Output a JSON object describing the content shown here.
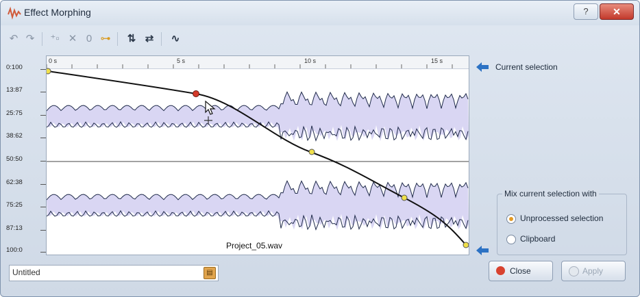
{
  "window": {
    "title": "Effect Morphing"
  },
  "titlebar": {
    "help_label": "?",
    "close_label": "✕"
  },
  "toolbar": {
    "icons": [
      "undo-icon",
      "redo-icon",
      "add-point-icon",
      "remove-point-icon",
      "zero-icon",
      "link-icon",
      "flip-vertical-icon",
      "swap-icon",
      "curve-icon"
    ]
  },
  "axis": {
    "labels": [
      "0:100",
      "13:87",
      "25:75",
      "38:62",
      "50:50",
      "62:38",
      "75:25",
      "87:13",
      "100:0"
    ]
  },
  "ruler": {
    "labels": [
      "0 s",
      "5 s",
      "10 s",
      "15 s"
    ]
  },
  "waveform": {
    "file_name": "Project_05.wav"
  },
  "curve": {
    "points_description": "0:100 at 0s, ~13:87 at ~6s, ~40:60 at ~10.5s, ~70:30 at ~14s, 100:0 at ~16.5s"
  },
  "side": {
    "current_selection_label": "Current selection"
  },
  "mix": {
    "legend": "Mix current selection with",
    "options": [
      "Unprocessed selection",
      "Clipboard"
    ],
    "selected": "Unprocessed selection"
  },
  "preset": {
    "value": "Untitled"
  },
  "buttons": {
    "close_label": "Close",
    "apply_label": "Apply"
  },
  "colors": {
    "accent_orange": "#e49a24",
    "wave_fill": "#d9d6f3",
    "wave_line": "#1f2a4a"
  }
}
